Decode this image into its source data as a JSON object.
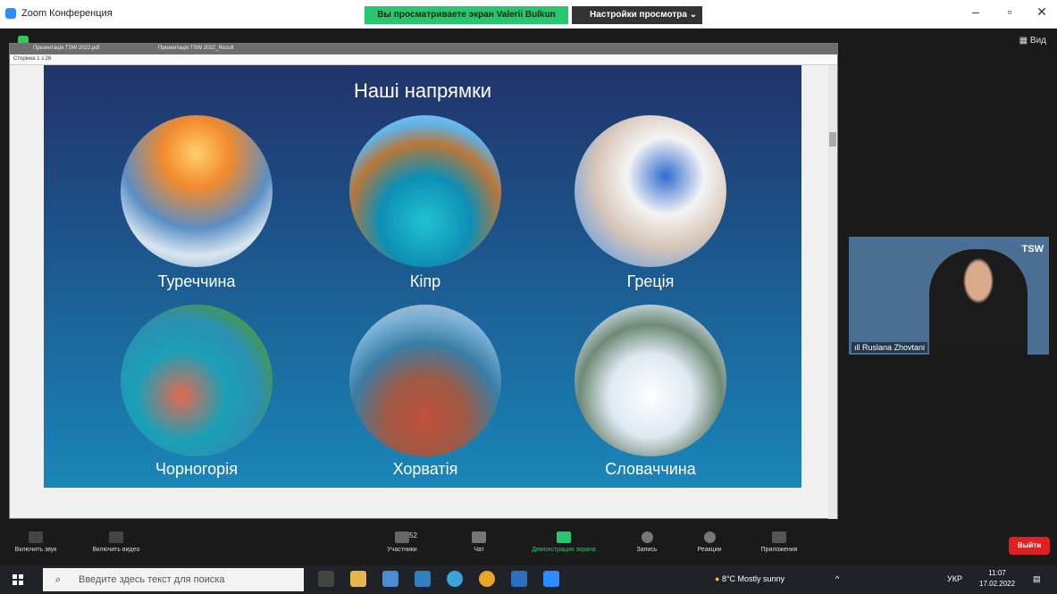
{
  "window": {
    "title": "Zoom Конференция",
    "share_banner": "Вы просматриваете экран Valerii Bulkun",
    "view_settings": "Настройки просмотра",
    "controls": {
      "minimize": "–",
      "maximize": "▫",
      "close": "✕"
    }
  },
  "top": {
    "view_label": "Вид"
  },
  "pdf": {
    "tab1": "Презентація TSW 2022.pdf",
    "tab2": "Презентація TSW 2022_Rezult",
    "toolbar": "Сторінка 1 з 26"
  },
  "slide": {
    "title": "Наші напрямки",
    "destinations": [
      "Туреччина",
      "Кіпр",
      "Греція",
      "Чорногорія",
      "Хорватія",
      "Словаччина"
    ]
  },
  "participant": {
    "name": "Ruslana Zhovtani",
    "logo": "TSW"
  },
  "toolbar": {
    "mute": "Включить звук",
    "video": "Включить видео",
    "participants": "Участники",
    "participants_count": "52",
    "chat": "Чат",
    "share": "Демонстрация экрана",
    "record": "Запись",
    "reactions": "Реакции",
    "apps": "Приложения",
    "leave": "Выйти"
  },
  "taskbar": {
    "search_placeholder": "Введите здесь текст для поиска",
    "weather": "8°C  Mostly sunny",
    "lang": "УКР",
    "time": "11:07",
    "date": "17.02.2022"
  },
  "colors": {
    "share_green": "#28c76f",
    "leave_red": "#e02020",
    "slide_top": "#22336a",
    "slide_bottom": "#1a86b8"
  }
}
